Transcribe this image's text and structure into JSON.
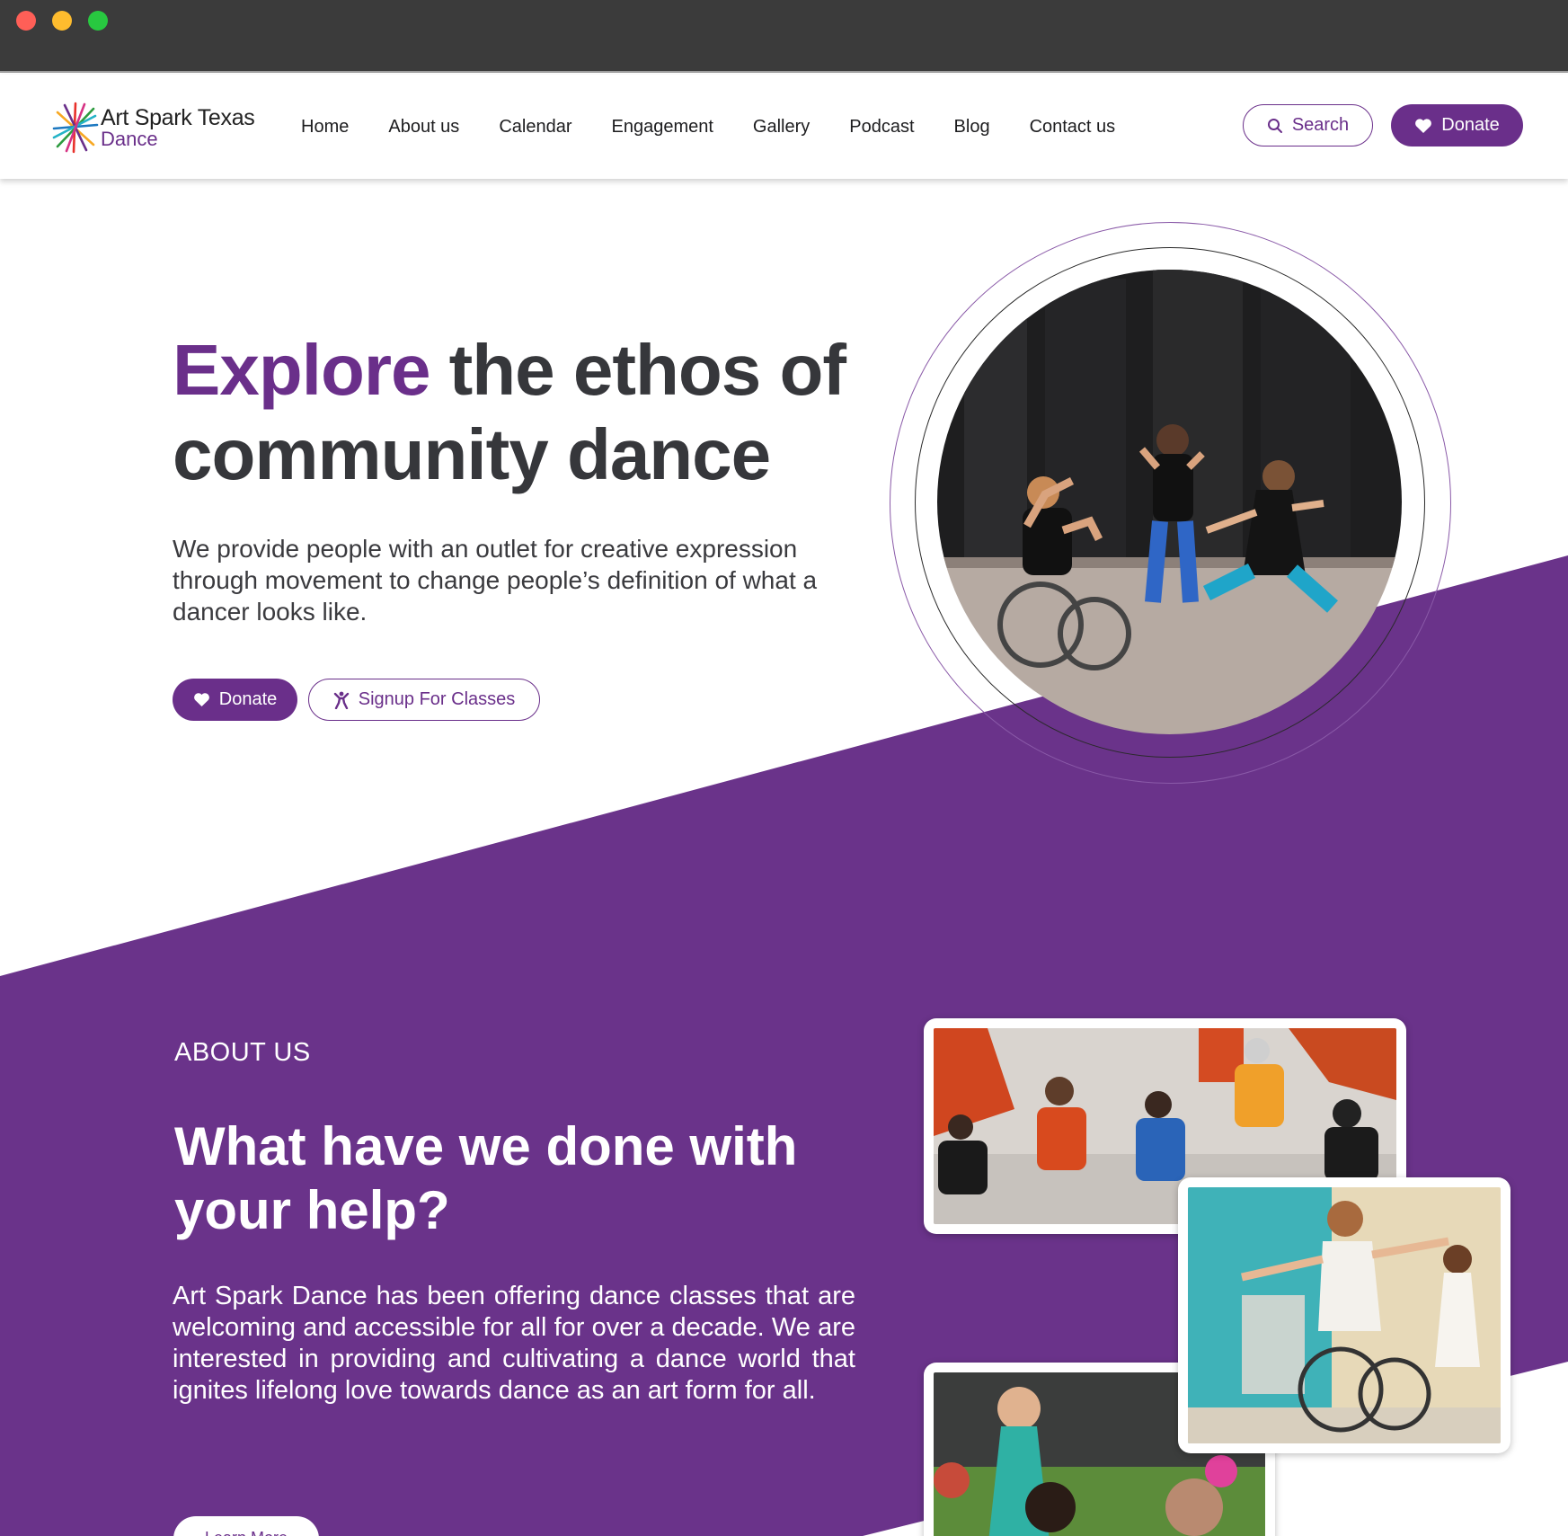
{
  "window": {
    "controls": [
      "close",
      "minimize",
      "maximize"
    ]
  },
  "brand": {
    "line1": "Art Spark Texas",
    "line2": "Dance",
    "purple": "#6a2f8a"
  },
  "nav": {
    "items": [
      "Home",
      "About us",
      "Calendar",
      "Engagement",
      "Gallery",
      "Podcast",
      "Blog",
      "Contact us"
    ],
    "search_label": "Search",
    "donate_label": "Donate"
  },
  "hero": {
    "title_accent": "Explore",
    "title_rest": " the ethos of community dance",
    "description": "We provide people with an outlet for creative expression through movement to change people’s definition of what a dancer looks like.",
    "donate_label": "Donate",
    "signup_label": "Signup For Classes"
  },
  "about": {
    "kicker": "ABOUT US",
    "title": "What have we done with your help?",
    "text": "Art Spark Dance has been offering dance classes that are welcoming and accessible for all for over a decade. We are interested in providing and cultivating a dance world that ignites lifelong love towards dance as an art form for all.",
    "learn_more_label": "Learn More"
  },
  "images": {
    "hero": "dancers-with-wheelchair-outdoor",
    "gallery": [
      "group-seated-circle",
      "wheelchair-dancer-austin",
      "dancers-outdoor-green"
    ]
  }
}
